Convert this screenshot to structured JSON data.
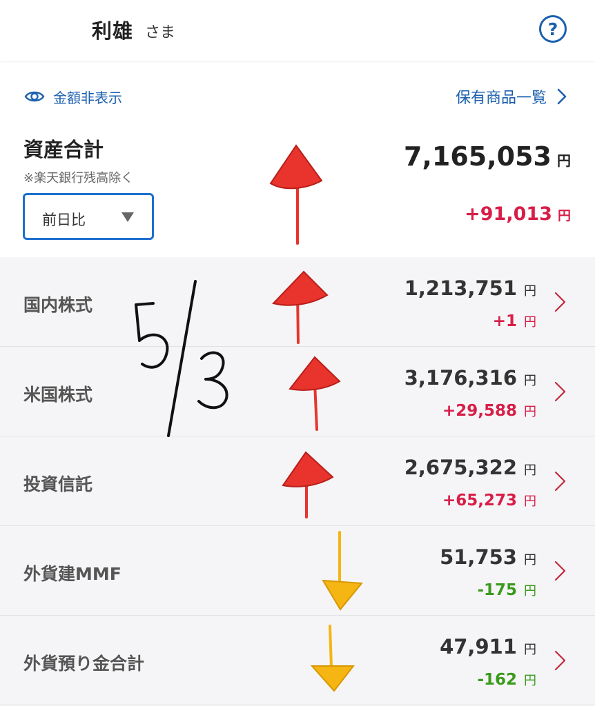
{
  "header": {
    "user_name": "利雄",
    "honorific": "さま",
    "help_label": "?"
  },
  "toolbar": {
    "hide_amounts_label": "金額非表示",
    "holdings_link_label": "保有商品一覧"
  },
  "summary": {
    "title": "資産合計",
    "note": "※楽天銀行残高除く",
    "total_value": "7,165,053",
    "currency": "円",
    "period_selected": "前日比",
    "change_value": "+91,013"
  },
  "assets": [
    {
      "label": "国内株式",
      "value": "1,213,751",
      "change": "+1",
      "direction": "up"
    },
    {
      "label": "米国株式",
      "value": "3,176,316",
      "change": "+29,588",
      "direction": "up"
    },
    {
      "label": "投資信託",
      "value": "2,675,322",
      "change": "+65,273",
      "direction": "up"
    },
    {
      "label": "外貨建MMF",
      "value": "51,753",
      "change": "-175",
      "direction": "down"
    },
    {
      "label": "外貨預り金合計",
      "value": "47,911",
      "change": "-162",
      "direction": "down"
    }
  ],
  "colors": {
    "accent": "#1b5fae",
    "gain": "#d81e48",
    "loss": "#3a9a1c",
    "annotation_up": "#e8342c",
    "annotation_down": "#f5b512"
  },
  "annotation": {
    "handwritten_date": "5/3"
  }
}
